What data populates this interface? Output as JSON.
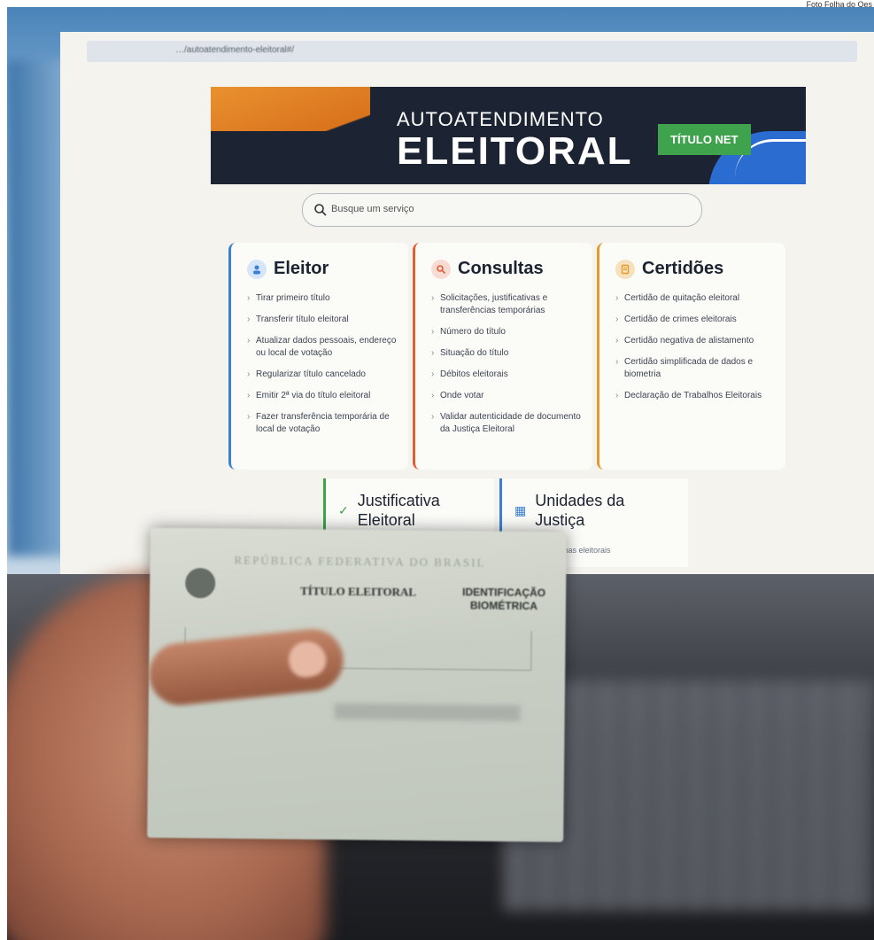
{
  "photo_credit": "Foto Folha do Oes",
  "browser": {
    "url": "…/autoatendimento-eleitoral#/"
  },
  "banner": {
    "title_small": "AUTOATENDIMENTO",
    "title_big": "ELEITORAL",
    "badge": "TÍTULO NET"
  },
  "search": {
    "placeholder": "Busque um serviço"
  },
  "cards": {
    "eleitor": {
      "title": "Eleitor",
      "items": [
        "Tirar primeiro título",
        "Transferir título eleitoral",
        "Atualizar dados pessoais, endereço ou local de votação",
        "Regularizar título cancelado",
        "Emitir 2ª via do título eleitoral",
        "Fazer transferência temporária de local de votação"
      ]
    },
    "consultas": {
      "title": "Consultas",
      "items": [
        "Solicitações, justificativas e transferências temporárias",
        "Número do título",
        "Situação do título",
        "Débitos eleitorais",
        "Onde votar",
        "Validar autenticidade de documento da Justiça Eleitoral"
      ]
    },
    "certidoes": {
      "title": "Certidões",
      "items": [
        "Certidão de quitação eleitoral",
        "Certidão de crimes eleitorais",
        "Certidão negativa de alistamento",
        "Certidão simplificada de dados e biometria",
        "Declaração de Trabalhos Eleitorais"
      ]
    }
  },
  "lower_cards": {
    "justificativa": {
      "title": "Justificativa Eleitoral"
    },
    "unidades": {
      "title": "Unidades da Justiça",
      "subtitle": "zonas eleitorais"
    }
  },
  "id_card": {
    "header": "REPÚBLICA FEDERATIVA DO BRASIL",
    "title": "TÍTULO ELEITORAL",
    "biometric": "IDENTIFICAÇÃO BIOMÉTRICA"
  },
  "colors": {
    "eleitor_accent": "#3b7fd4",
    "consultas_accent": "#e25c35",
    "certidoes_accent": "#e49a2c",
    "badge_green": "#3fa34d",
    "banner_dark": "#1c2433"
  }
}
